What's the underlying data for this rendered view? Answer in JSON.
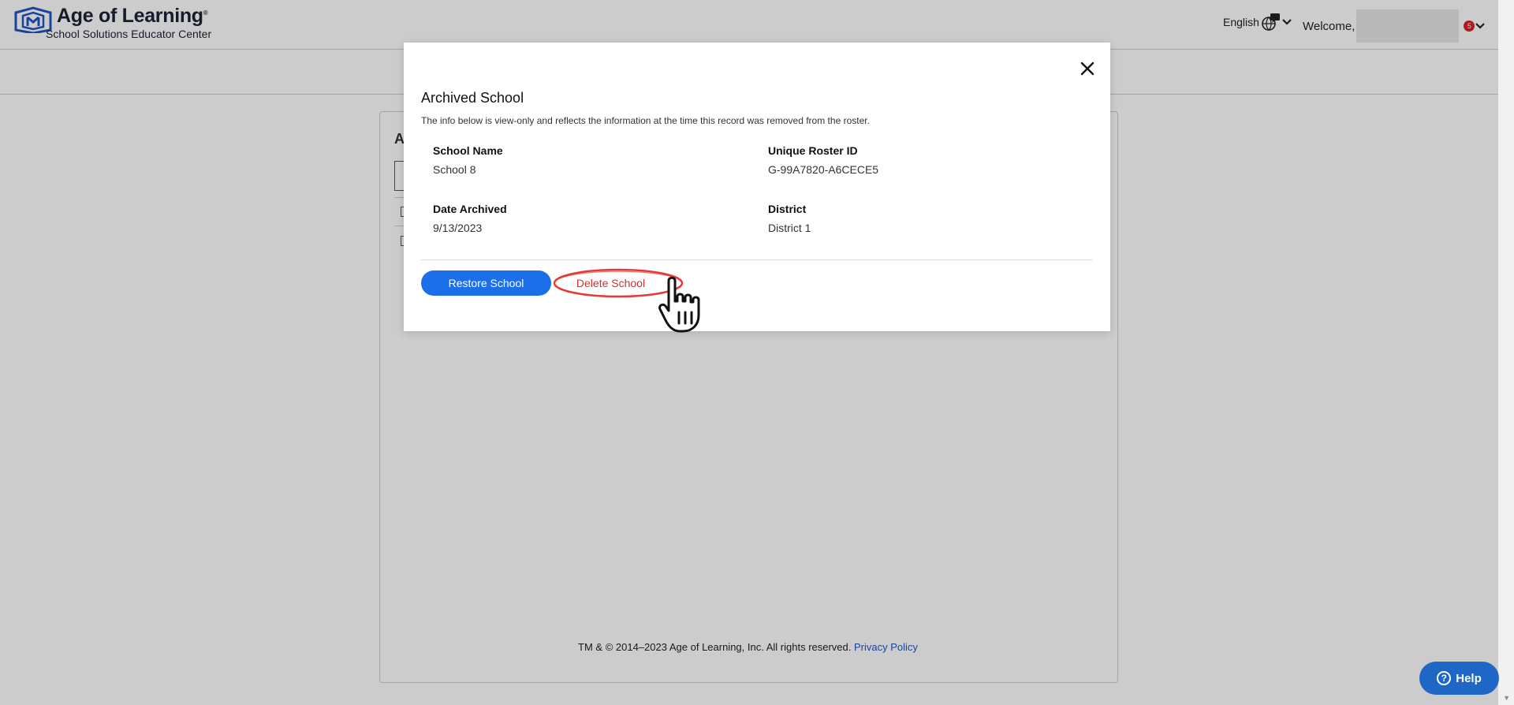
{
  "header": {
    "brand_title": "Age of Learning",
    "brand_trademark": "®",
    "brand_subtitle": "School Solutions Educator Center",
    "language_label": "English",
    "welcome_label": "Welcome,",
    "notification_count": "5"
  },
  "card": {
    "title_initial": "A"
  },
  "modal": {
    "title": "Archived School",
    "description": "The info below is view-only and reflects the information at the time this record was removed from the roster.",
    "fields": {
      "school_name_label": "School Name",
      "school_name_value": "School 8",
      "roster_id_label": "Unique Roster ID",
      "roster_id_value": "G-99A7820-A6CECE5",
      "date_archived_label": "Date Archived",
      "date_archived_value": "9/13/2023",
      "district_label": "District",
      "district_value": "District 1"
    },
    "restore_button": "Restore School",
    "delete_button": "Delete School"
  },
  "footer": {
    "copyright": "TM & © 2014–2023 Age of Learning, Inc. All rights reserved.",
    "privacy_link": "Privacy Policy"
  },
  "help": {
    "label": "Help"
  },
  "colors": {
    "primary_blue": "#1b6fe8",
    "delete_red": "#d42e2e",
    "highlight_red": "#e53935",
    "help_blue": "#1f67c4"
  }
}
